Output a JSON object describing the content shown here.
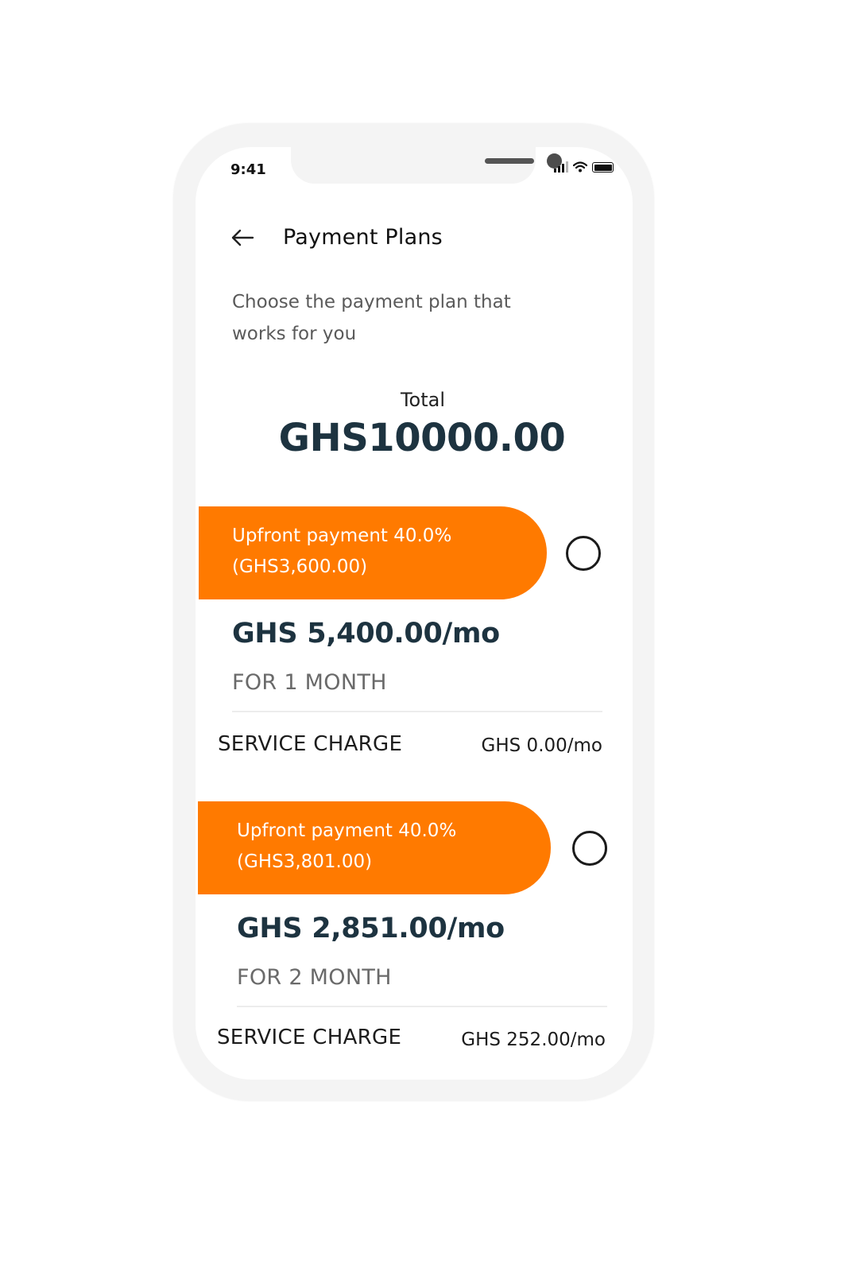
{
  "status_bar": {
    "time": "9:41",
    "icons": [
      "signal-icon",
      "wifi-icon",
      "battery-icon"
    ]
  },
  "header": {
    "back_icon": "arrow-left-icon",
    "title": "Payment Plans"
  },
  "subtitle": "Choose the payment plan that works for you",
  "total": {
    "label": "Total",
    "amount": "GHS10000.00"
  },
  "plans": [
    {
      "upfront_line1": "Upfront payment 40.0%",
      "upfront_line2": "(GHS3,600.00)",
      "monthly": "GHS 5,400.00/mo",
      "duration": "FOR 1 MONTH",
      "service_label": "SERVICE CHARGE",
      "service_value": "GHS 0.00/mo",
      "selected": false
    },
    {
      "upfront_line1": "Upfront payment 40.0%",
      "upfront_line2": "(GHS3,801.00)",
      "monthly": "GHS 2,851.00/mo",
      "duration": "FOR 2 MONTH",
      "service_label": "SERVICE CHARGE",
      "service_value": "GHS 252.00/mo",
      "selected": false
    }
  ],
  "colors": {
    "accent": "#ff7a00",
    "amount_text": "#1d3340",
    "muted_text": "#6a6a6a"
  }
}
